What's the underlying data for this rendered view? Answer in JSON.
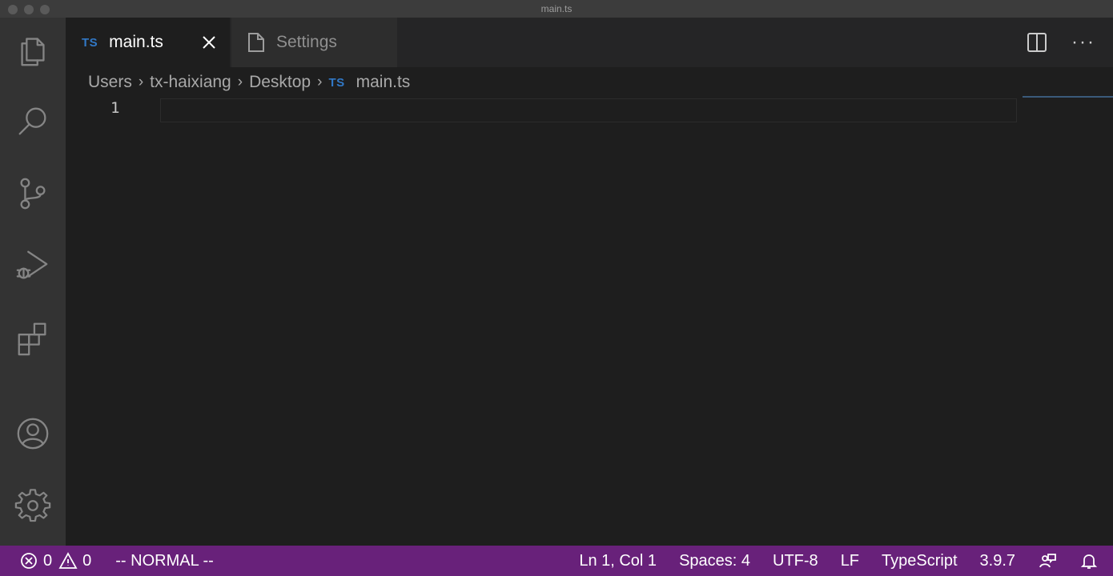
{
  "window": {
    "title": "main.ts"
  },
  "activity_bar": {
    "items": [
      {
        "name": "explorer",
        "icon": "files-icon"
      },
      {
        "name": "search",
        "icon": "search-icon"
      },
      {
        "name": "source-control",
        "icon": "source-control-icon"
      },
      {
        "name": "run-and-debug",
        "icon": "run-debug-icon"
      },
      {
        "name": "extensions",
        "icon": "extensions-icon"
      }
    ],
    "bottom_items": [
      {
        "name": "accounts",
        "icon": "account-icon"
      },
      {
        "name": "manage",
        "icon": "gear-icon"
      }
    ]
  },
  "tabs": [
    {
      "label": "main.ts",
      "badge": "TS",
      "active": true,
      "icon": "typescript-icon"
    },
    {
      "label": "Settings",
      "active": false,
      "icon": "file-icon"
    }
  ],
  "breadcrumb": {
    "items": [
      "Users",
      "tx-haixiang",
      "Desktop"
    ],
    "file_badge": "TS",
    "file": "main.ts"
  },
  "editor": {
    "line_numbers": [
      "1"
    ],
    "content": ""
  },
  "status_bar": {
    "errors": "0",
    "warnings": "0",
    "vim_mode": "-- NORMAL --",
    "cursor": "Ln 1, Col 1",
    "indentation": "Spaces: 4",
    "encoding": "UTF-8",
    "eol": "LF",
    "language": "TypeScript",
    "version": "3.9.7"
  },
  "colors": {
    "status_bar": "#68217a",
    "activity_bar": "#333333",
    "editor_bg": "#1e1e1e",
    "ts_blue": "#3178c6"
  }
}
